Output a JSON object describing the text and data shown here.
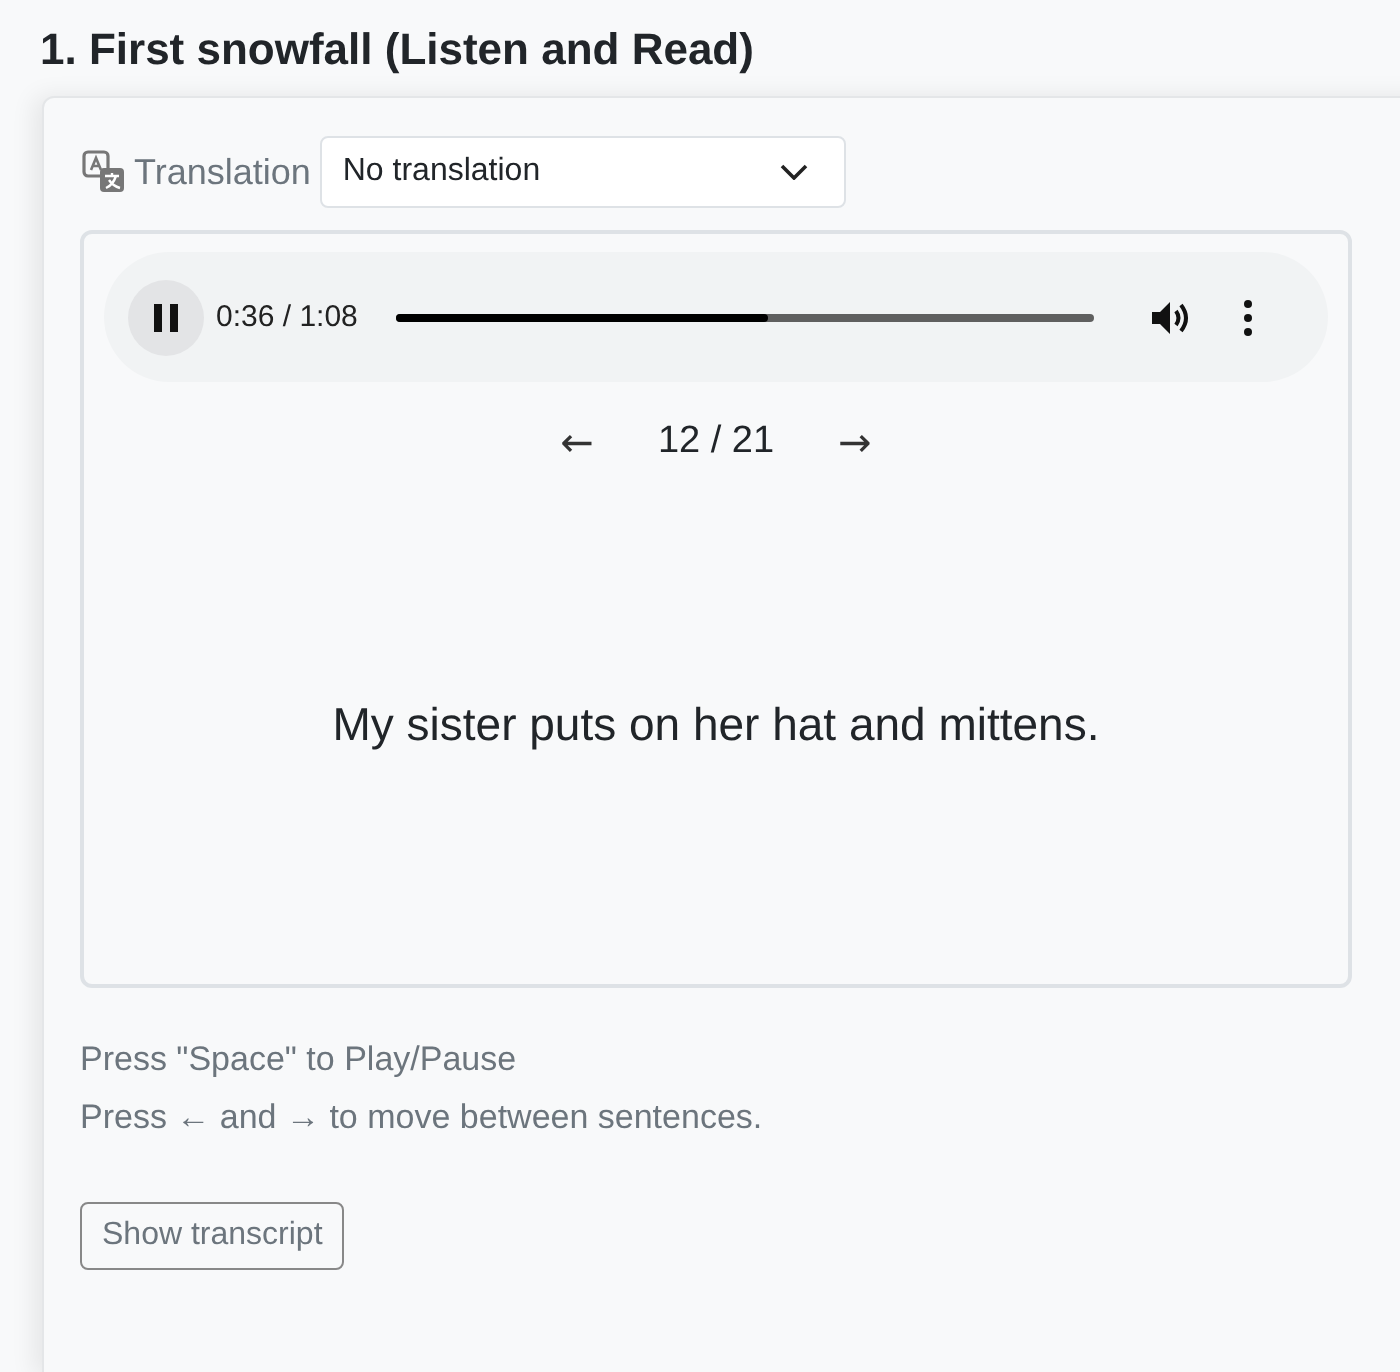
{
  "heading": "1. First snowfall (Listen and Read)",
  "translation": {
    "label": "Translation",
    "value": "No translation"
  },
  "player": {
    "playing": true,
    "time": "0:36 / 1:08",
    "level": 0.533
  },
  "navigation": {
    "previous": "←",
    "position": "12 / 21",
    "next": "→"
  },
  "sentence": "My sister puts on her hat and mittens.",
  "hints": [
    "Press \"Space\" to Play/Pause",
    "Press ← and → to move between sentences."
  ],
  "buttons": [
    "Show transcript"
  ]
}
